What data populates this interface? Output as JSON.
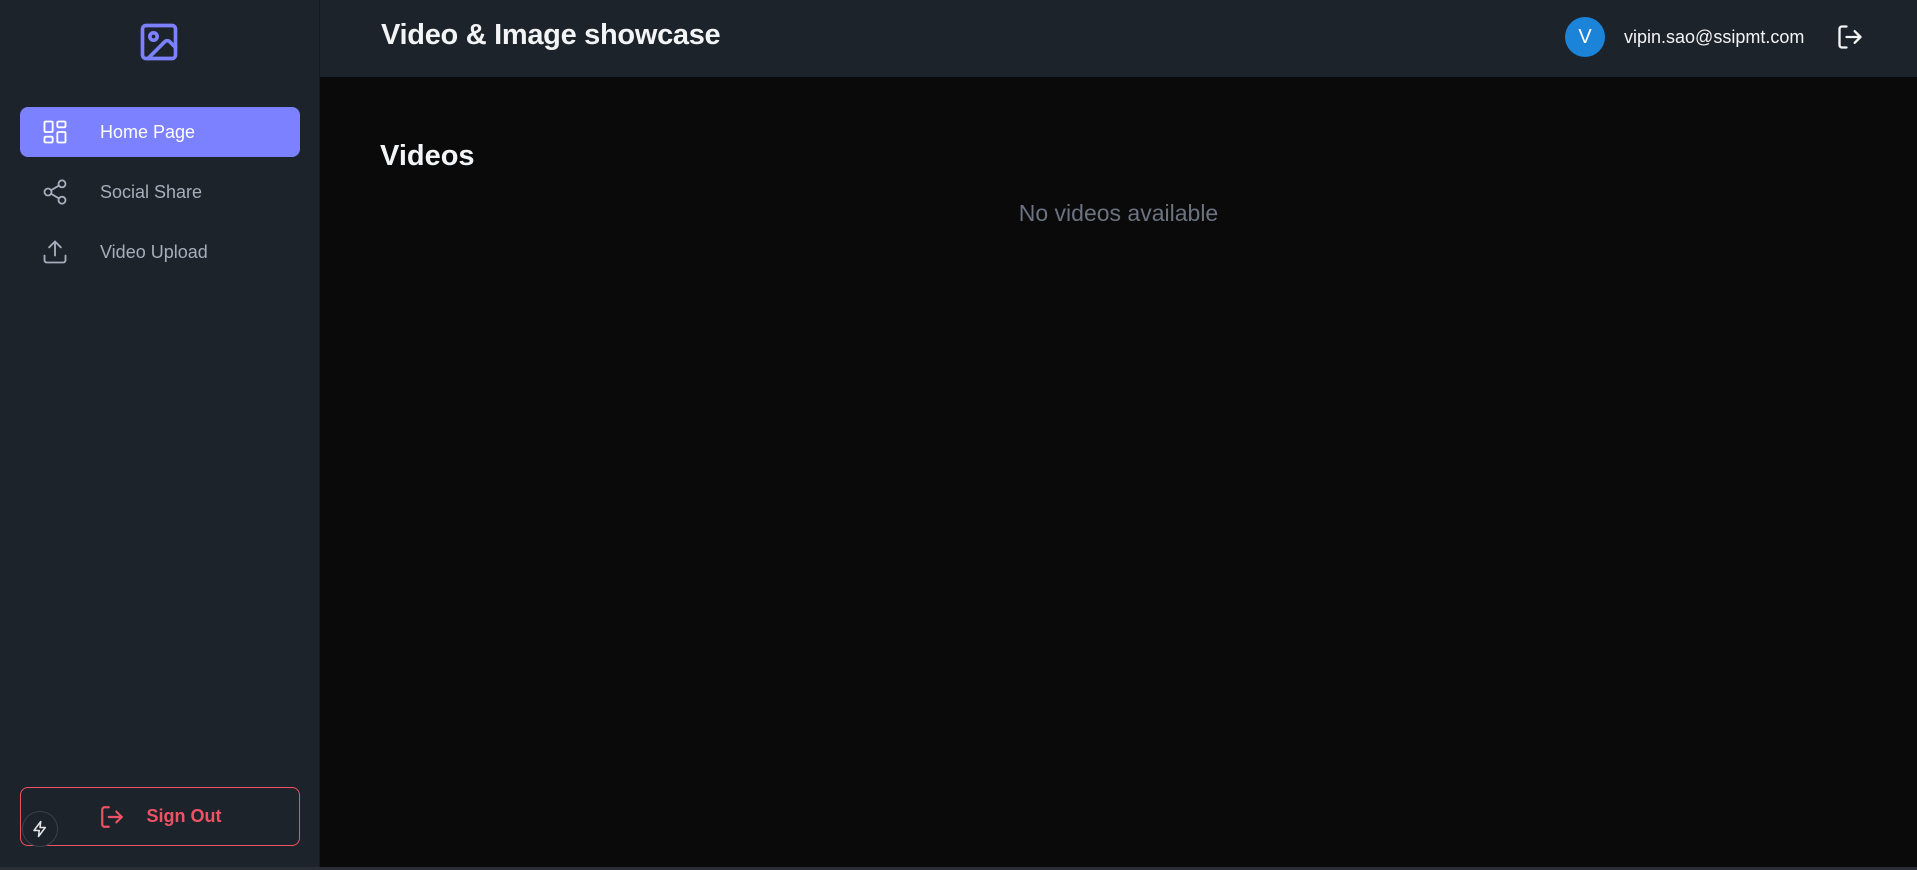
{
  "header": {
    "title": "Video & Image showcase",
    "avatar_initial": "V",
    "user_email": "vipin.sao@ssipmt.com",
    "logout_icon": "logout-icon"
  },
  "sidebar": {
    "logo_icon": "image-icon",
    "items": [
      {
        "label": "Home Page",
        "icon": "dashboard-icon",
        "active": true
      },
      {
        "label": "Social Share",
        "icon": "share-icon",
        "active": false
      },
      {
        "label": "Video Upload",
        "icon": "upload-icon",
        "active": false
      }
    ],
    "sign_out_label": "Sign Out"
  },
  "main": {
    "section_title": "Videos",
    "empty_message": "No videos available"
  },
  "colors": {
    "accent": "#7b81ff",
    "danger": "#f05265",
    "avatar": "#1b84d8",
    "sidebar_bg": "#1d232a",
    "main_bg": "#0a0a0a"
  }
}
